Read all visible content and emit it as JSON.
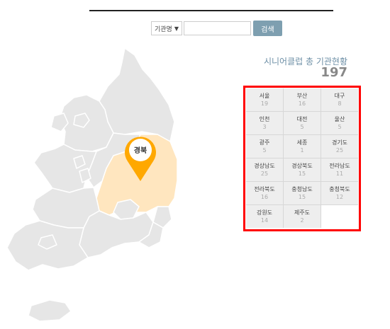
{
  "search": {
    "select_value": "기관명",
    "input_value": "",
    "button_label": "검색"
  },
  "map": {
    "selected_region": "경북",
    "colors": {
      "region_default": "#e6e6e6",
      "region_selected": "#ffe6bf",
      "pin": "#ffa800"
    }
  },
  "summary": {
    "title": "시니어클럽 총 기관현황",
    "total": "197"
  },
  "regions": [
    {
      "name": "서울",
      "count": "19"
    },
    {
      "name": "부산",
      "count": "16"
    },
    {
      "name": "대구",
      "count": "8"
    },
    {
      "name": "인천",
      "count": "3"
    },
    {
      "name": "대전",
      "count": "5"
    },
    {
      "name": "울산",
      "count": "5"
    },
    {
      "name": "광주",
      "count": "5"
    },
    {
      "name": "세종",
      "count": "1"
    },
    {
      "name": "경기도",
      "count": "25"
    },
    {
      "name": "경상남도",
      "count": "25"
    },
    {
      "name": "경상북도",
      "count": "15"
    },
    {
      "name": "전라남도",
      "count": "11"
    },
    {
      "name": "전라북도",
      "count": "16"
    },
    {
      "name": "충청남도",
      "count": "15"
    },
    {
      "name": "충청북도",
      "count": "12"
    },
    {
      "name": "강원도",
      "count": "14"
    },
    {
      "name": "제주도",
      "count": "2"
    }
  ],
  "colors": {
    "highlight_border": "#ff0000",
    "search_button": "#7e9fb0"
  }
}
